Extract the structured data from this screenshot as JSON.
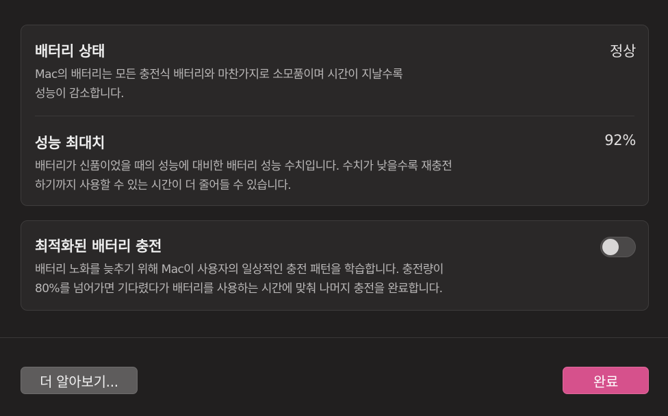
{
  "battery_status": {
    "title": "배터리 상태",
    "value": "정상",
    "description_line1": "Mac의 배터리는 모든 충전식 배터리와 마찬가지로 소모품이며 시간이 지날수록",
    "description_line2": "성능이 감소합니다."
  },
  "max_capacity": {
    "title": "성능 최대치",
    "value": "92%",
    "description_line1": "배터리가 신품이었을 때의 성능에 대비한 배터리 성능 수치입니다. 수치가 낮을수록 재충전",
    "description_line2": "하기까지 사용할 수 있는 시간이 더 줄어들 수 있습니다."
  },
  "optimized_charging": {
    "title": "최적화된 배터리 충전",
    "enabled": false,
    "description_line1": "배터리 노화를 늦추기 위해 Mac이 사용자의 일상적인 충전 패턴을 학습합니다. 충전량이",
    "description_line2": "80%를 넘어가면 기다렸다가 배터리를 사용하는 시간에 맞춰 나머지 충전을 완료합니다."
  },
  "buttons": {
    "learn_more": "더 알아보기...",
    "done": "완료"
  },
  "colors": {
    "accent": "#d6518c",
    "background": "#211f1f",
    "card": "#2a2828"
  }
}
